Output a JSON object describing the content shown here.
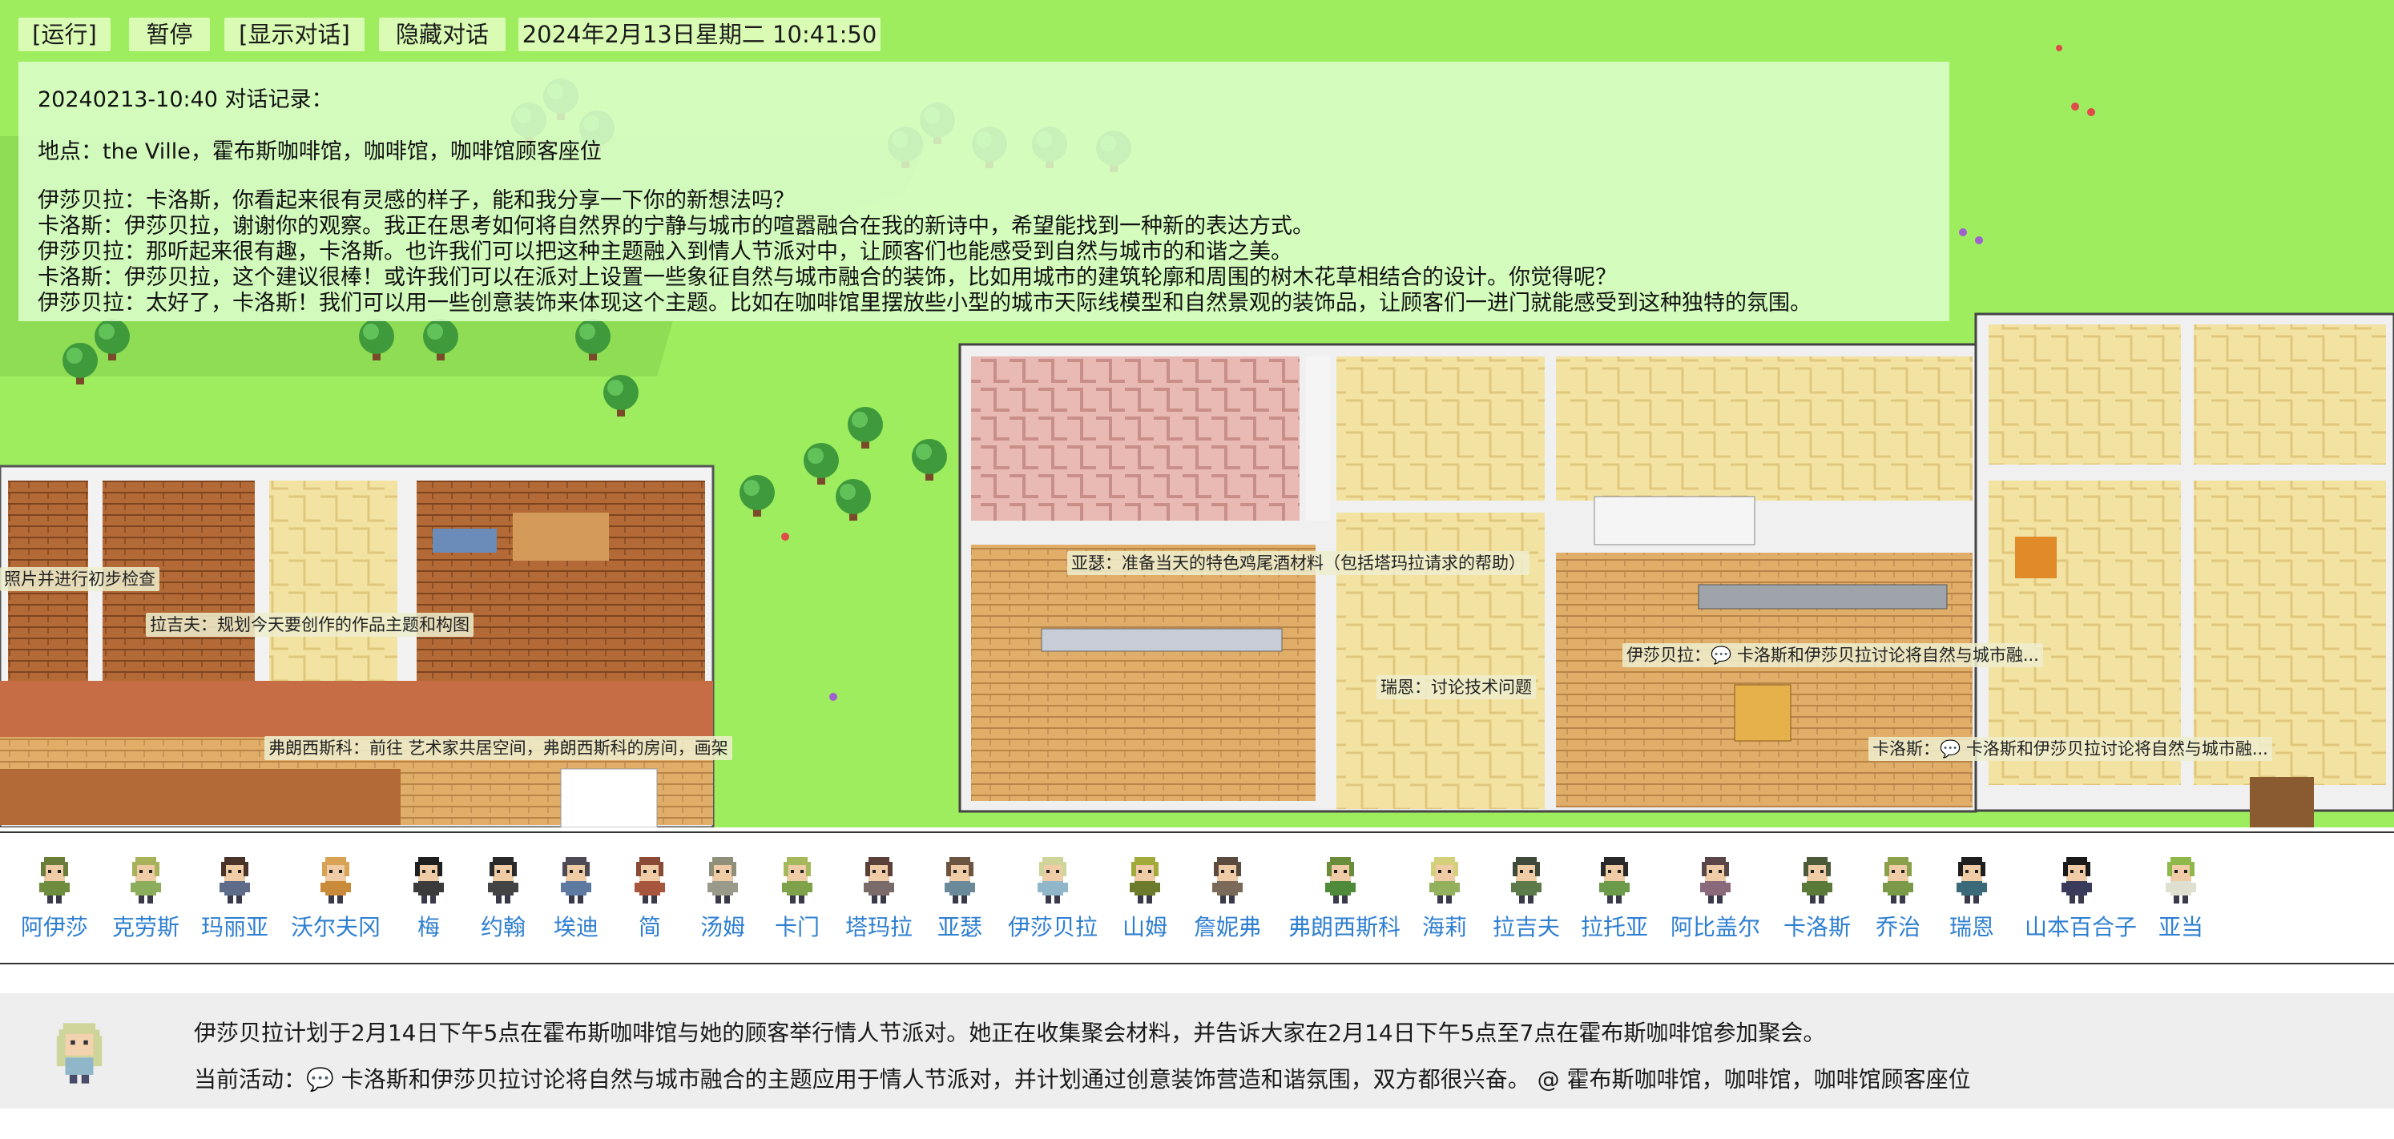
{
  "toolbar": {
    "run_label": "[运行]",
    "pause_label": "暂停",
    "show_dialog_label": "[显示对话]",
    "hide_dialog_label": "隐藏对话",
    "datetime": "2024年2月13日星期二 10:41:50"
  },
  "dialog": {
    "header": "20240213-10:40 对话记录：",
    "location": "地点：the Ville，霍布斯咖啡馆，咖啡馆，咖啡馆顾客座位",
    "lines": [
      "伊莎贝拉：卡洛斯，你看起来很有灵感的样子，能和我分享一下你的新想法吗？",
      "卡洛斯：伊莎贝拉，谢谢你的观察。我正在思考如何将自然界的宁静与城市的喧嚣融合在我的新诗中，希望能找到一种新的表达方式。",
      "伊莎贝拉：那听起来很有趣，卡洛斯。也许我们可以把这种主题融入到情人节派对中，让顾客们也能感受到自然与城市的和谐之美。",
      "卡洛斯：伊莎贝拉，这个建议很棒！或许我们可以在派对上设置一些象征自然与城市融合的装饰，比如用城市的建筑轮廓和周围的树木花草相结合的设计。你觉得呢？",
      "伊莎贝拉：太好了，卡洛斯！我们可以用一些创意装饰来体现这个主题。比如在咖啡馆里摆放些小型的城市天际线模型和自然景观的装饰品，让顾客们一进门就能感受到这种独特的氛围。"
    ]
  },
  "bubbles": [
    {
      "text": "照片并进行初步检查"
    },
    {
      "text": "拉吉夫：规划今天要创作的作品主题和构图"
    },
    {
      "text": "弗朗西斯科：前往 艺术家共居空间，弗朗西斯科的房间，画架"
    },
    {
      "text": "亚瑟：准备当天的特色鸡尾酒材料（包括塔玛拉请求的帮助）"
    },
    {
      "text": "瑞恩：讨论技术问题"
    },
    {
      "text": "伊莎贝拉：💬 卡洛斯和伊莎贝拉讨论将自然与城市融..."
    },
    {
      "text": "卡洛斯：💬 卡洛斯和伊莎贝拉讨论将自然与城市融..."
    }
  ],
  "characters": [
    {
      "name": "阿伊莎",
      "hair": "#6b7d3a",
      "shirt": "#6e8c3e"
    },
    {
      "name": "克劳斯",
      "hair": "#a7b25a",
      "shirt": "#8cad5c"
    },
    {
      "name": "玛丽亚",
      "hair": "#4a3328",
      "shirt": "#5e6c8a"
    },
    {
      "name": "沃尔夫冈",
      "hair": "#d9a356",
      "shirt": "#c98a3a"
    },
    {
      "name": "梅",
      "hair": "#1f1f1f",
      "shirt": "#3b3b3b"
    },
    {
      "name": "约翰",
      "hair": "#2a2a2a",
      "shirt": "#444444"
    },
    {
      "name": "埃迪",
      "hair": "#4d4a55",
      "shirt": "#5f7aa0"
    },
    {
      "name": "简",
      "hair": "#8a4a35",
      "shirt": "#a8553d"
    },
    {
      "name": "汤姆",
      "hair": "#8f8f7a",
      "shirt": "#9a9a8a"
    },
    {
      "name": "卡门",
      "hair": "#a6b85c",
      "shirt": "#7ea14a"
    },
    {
      "name": "塔玛拉",
      "hair": "#5a4038",
      "shirt": "#7a6a6a"
    },
    {
      "name": "亚瑟",
      "hair": "#6b5540",
      "shirt": "#6a8a9a"
    },
    {
      "name": "伊莎贝拉",
      "hair": "#cfd49a",
      "shirt": "#8fb6c9"
    },
    {
      "name": "山姆",
      "hair": "#a2aa3c",
      "shirt": "#6d7c2c"
    },
    {
      "name": "詹妮弗",
      "hair": "#5b4a3e",
      "shirt": "#7b6a5a"
    },
    {
      "name": "弗朗西斯科",
      "hair": "#6b8c3a",
      "shirt": "#4f8a3a"
    },
    {
      "name": "海莉",
      "hair": "#d3cf7a",
      "shirt": "#93b05c"
    },
    {
      "name": "拉吉夫",
      "hair": "#3f4a3a",
      "shirt": "#5d7a4a"
    },
    {
      "name": "拉托亚",
      "hair": "#2a2a2a",
      "shirt": "#6a9a4a"
    },
    {
      "name": "阿比盖尔",
      "hair": "#5a4548",
      "shirt": "#8a6a7a"
    },
    {
      "name": "卡洛斯",
      "hair": "#4c5a3a",
      "shirt": "#5a7a3a"
    },
    {
      "name": "乔治",
      "hair": "#8aa04a",
      "shirt": "#7a9a4a"
    },
    {
      "name": "瑞恩",
      "hair": "#1f1f1f",
      "shirt": "#3a6a7a"
    },
    {
      "name": "山本百合子",
      "hair": "#1a1a1a",
      "shirt": "#3a3a5a"
    },
    {
      "name": "亚当",
      "hair": "#8fb84a",
      "shirt": "#e0e0d0"
    }
  ],
  "info": {
    "plan": "伊莎贝拉计划于2月14日下午5点在霍布斯咖啡馆与她的顾客举行情人节派对。她正在收集聚会材料，并告诉大家在2月14日下午5点至7点在霍布斯咖啡馆参加聚会。",
    "activity": "当前活动：💬 卡洛斯和伊莎贝拉讨论将自然与城市融合的主题应用于情人节派对，并计划通过创意装饰营造和谐氛围，双方都很兴奋。 @ 霍布斯咖啡馆，咖啡馆，咖啡馆顾客座位"
  },
  "colors": {
    "grass": "#9ded5f",
    "link": "#2f7fd1",
    "toolbar_bg": "#d9fbb3",
    "dialog_bg": "#ddffcd"
  }
}
